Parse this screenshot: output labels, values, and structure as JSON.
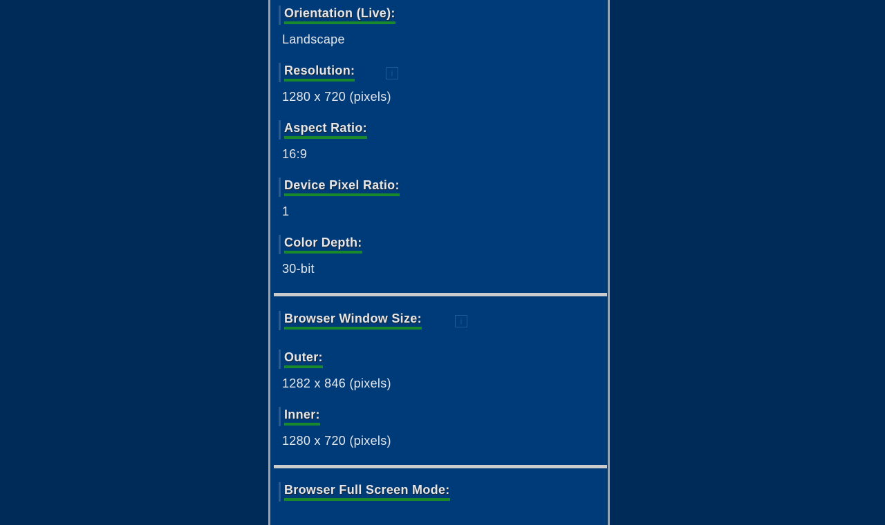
{
  "display": {
    "orientation": {
      "label": "Orientation (Live):",
      "value": "Landscape"
    },
    "resolution": {
      "label": "Resolution:",
      "value": "1280 x 720 (pixels)",
      "info": "i"
    },
    "aspect_ratio": {
      "label": "Aspect Ratio:",
      "value": "16:9"
    },
    "device_pixel_ratio": {
      "label": "Device Pixel Ratio:",
      "value": "1"
    },
    "color_depth": {
      "label": "Color Depth:",
      "value": "30-bit"
    }
  },
  "browser_window": {
    "label": "Browser Window Size:",
    "info": "i",
    "outer": {
      "label": "Outer:",
      "value": "1282 x 846 (pixels)"
    },
    "inner": {
      "label": "Inner:",
      "value": "1280 x 720 (pixels)"
    }
  },
  "full_screen": {
    "label": "Browser Full Screen Mode:"
  },
  "colors": {
    "background": "#002a57",
    "panel": "#003b79",
    "label_underline": "#188a2a",
    "text": "#e3e6ea"
  }
}
